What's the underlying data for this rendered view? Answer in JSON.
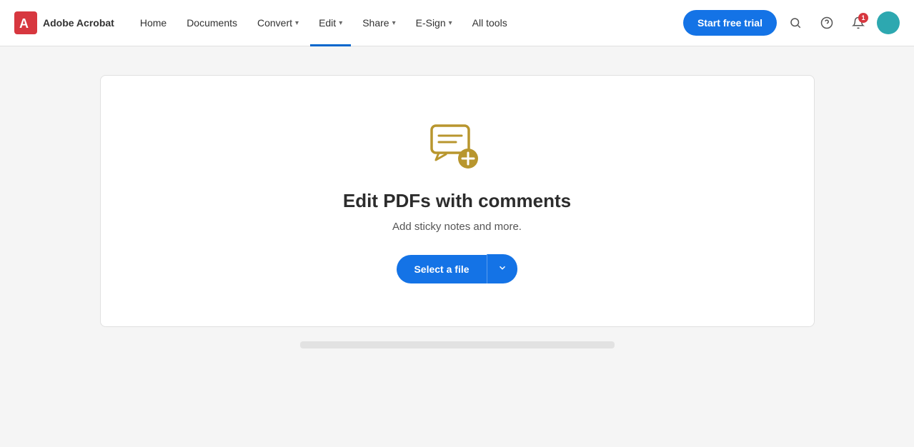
{
  "app": {
    "logo_text": "Adobe Acrobat"
  },
  "navbar": {
    "home_label": "Home",
    "documents_label": "Documents",
    "convert_label": "Convert",
    "edit_label": "Edit",
    "share_label": "Share",
    "esign_label": "E-Sign",
    "alltools_label": "All tools",
    "start_trial_label": "Start free trial",
    "notification_count": "1"
  },
  "card": {
    "title": "Edit PDFs with comments",
    "subtitle": "Add sticky notes and more.",
    "select_file_label": "Select a file"
  }
}
